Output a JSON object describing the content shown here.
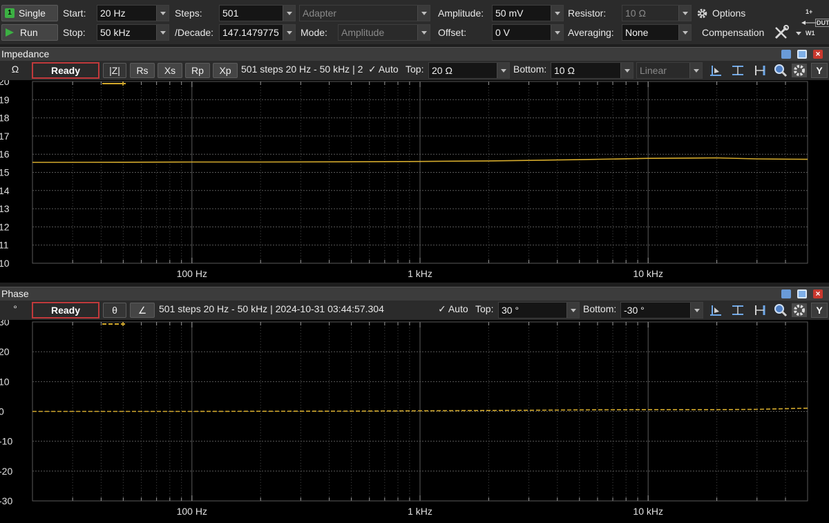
{
  "toolbar": {
    "single_badge": "1",
    "single_label": "Single",
    "run_label": "Run",
    "start_label": "Start:",
    "start_value": "20 Hz",
    "stop_label": "Stop:",
    "stop_value": "50 kHz",
    "steps_label": "Steps:",
    "steps_value": "501",
    "decade_label": "/Decade:",
    "decade_value": "147.1479775",
    "adapter_value": "Adapter",
    "mode_label": "Mode:",
    "mode_value": "Amplitude",
    "amplitude_label": "Amplitude:",
    "amplitude_value": "50 mV",
    "offset_label": "Offset:",
    "offset_value": "0 V",
    "resistor_label": "Resistor:",
    "resistor_value": "10 Ω",
    "averaging_label": "Averaging:",
    "averaging_value": "None",
    "options_label": "Options",
    "compensation_label": "Compensation",
    "dut_label": "DUT",
    "w1_label": "W1",
    "plus_label": "1+"
  },
  "impedance": {
    "title": "Impedance",
    "unit": "Ω",
    "status": "Ready",
    "buttons": [
      "|Z|",
      "Rs",
      "Xs",
      "Rp",
      "Xp"
    ],
    "info": "501 steps 20 Hz - 50 kHz | 2",
    "auto_label": "✓  Auto",
    "top_label": "Top:",
    "top_value": "20 Ω",
    "bottom_label": "Bottom:",
    "bottom_value": "10 Ω",
    "scale_value": "Linear",
    "y_button": "Y"
  },
  "phase": {
    "title": "Phase",
    "unit": "°",
    "status": "Ready",
    "buttons": [
      "θ",
      "∠"
    ],
    "info": "501 steps 20 Hz - 50 kHz | 2024-10-31 03:44:57.304",
    "auto_label": "✓  Auto",
    "top_label": "Top:",
    "top_value": "30 °",
    "bottom_label": "Bottom:",
    "bottom_value": "-30 °",
    "y_button": "Y"
  },
  "colors": {
    "trace": "#d4aa2c",
    "grid": "#5a5a5a",
    "ready_border": "#c0393b"
  },
  "chart_data": [
    {
      "type": "line",
      "panel": "Impedance",
      "x_scale": "log",
      "xlim": [
        20,
        50000
      ],
      "ylim": [
        10,
        20
      ],
      "yticks": [
        20,
        19,
        18,
        17,
        16,
        15,
        14,
        13,
        12,
        11,
        10
      ],
      "xticks": [
        {
          "value": 100,
          "label": "100 Hz"
        },
        {
          "value": 1000,
          "label": "1 kHz"
        },
        {
          "value": 10000,
          "label": "10 kHz"
        }
      ],
      "series": [
        {
          "x": [
            20,
            50,
            100,
            200,
            500,
            1000,
            2000,
            5000,
            10000,
            20000,
            30000,
            50000
          ],
          "y": [
            15.55,
            15.56,
            15.57,
            15.57,
            15.58,
            15.6,
            15.63,
            15.7,
            15.77,
            15.8,
            15.74,
            15.72
          ]
        }
      ]
    },
    {
      "type": "line",
      "panel": "Phase",
      "x_scale": "log",
      "xlim": [
        20,
        50000
      ],
      "ylim": [
        -30,
        30
      ],
      "yticks": [
        30,
        20,
        10,
        0,
        -10,
        -20,
        -30
      ],
      "xticks": [
        {
          "value": 100,
          "label": "100 Hz"
        },
        {
          "value": 1000,
          "label": "1 kHz"
        },
        {
          "value": 10000,
          "label": "10 kHz"
        }
      ],
      "series": [
        {
          "x": [
            20,
            50,
            100,
            200,
            500,
            1000,
            2000,
            5000,
            10000,
            20000,
            30000,
            50000
          ],
          "y": [
            0.0,
            0.0,
            0.0,
            0.05,
            0.1,
            0.2,
            0.3,
            0.5,
            0.6,
            0.6,
            0.7,
            1.1
          ]
        }
      ]
    }
  ]
}
